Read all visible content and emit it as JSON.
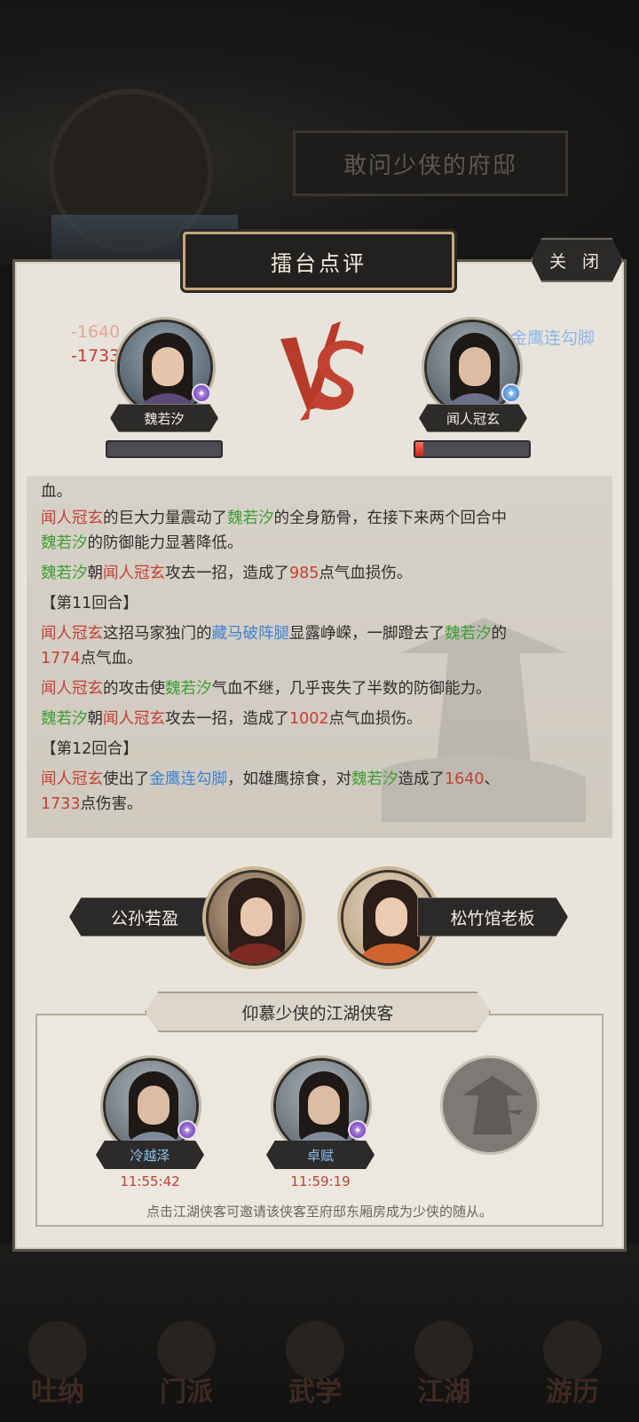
{
  "background": {
    "banner_text": "敢问少侠的府邸",
    "nav": [
      "吐纳",
      "门派",
      "武学",
      "江湖",
      "游历"
    ]
  },
  "dialog": {
    "title": "擂台点评",
    "close_label": "关 闭"
  },
  "fighters": {
    "left": {
      "name": "魏若汐",
      "damage_popups": [
        "-1640",
        "-1733"
      ],
      "hp_fraction": 0.0
    },
    "right": {
      "name": "闻人冠玄",
      "skill_popup": "金鹰连勾脚",
      "hp_fraction": 0.07
    }
  },
  "log": {
    "line0": "血。",
    "p1": {
      "a": "闻人冠玄",
      "b": "的巨大力量震动了",
      "c": "魏若汐",
      "d": "的全身筋骨，在接下来两个回合中",
      "e": "魏若汐",
      "f": "的防御能力显著降低。"
    },
    "p2": {
      "a": "魏若汐",
      "b": "朝",
      "c": "闻人冠玄",
      "d": "攻去一招，造成了",
      "e": "985",
      "f": "点气血损伤。"
    },
    "round11": "【第11回合】",
    "p3": {
      "a": "闻人冠玄",
      "b": "这招马家独门的",
      "c": "藏马破阵腿",
      "d": "显露峥嵘，一脚蹬去了",
      "e": "魏若汐",
      "f": "的",
      "g": "1774",
      "h": "点气血。"
    },
    "p4": {
      "a": "闻人冠玄",
      "b": "的攻击使",
      "c": "魏若汐",
      "d": "气血不继，几乎丧失了半数的防御能力。"
    },
    "p5": {
      "a": "魏若汐",
      "b": "朝",
      "c": "闻人冠玄",
      "d": "攻去一招，造成了",
      "e": "1002",
      "f": "点气血损伤。"
    },
    "round12": "【第12回合】",
    "p6": {
      "a": "闻人冠玄",
      "b": "使出了",
      "c": "金鹰连勾脚",
      "d": "，如雄鹰掠食，对",
      "e": "魏若汐",
      "f": "造成了",
      "g": "1640",
      "h": "、",
      "i": "1733",
      "j": "点伤害。"
    }
  },
  "guests": {
    "left": "公孙若盈",
    "right": "松竹馆老板"
  },
  "followers": {
    "title": "仰慕少侠的江湖侠客",
    "items": [
      {
        "name": "冷越泽",
        "timer": "11:55:42"
      },
      {
        "name": "卓赋",
        "timer": "11:59:19"
      }
    ],
    "hint": "点击江湖侠客可邀请该侠客至府邸东厢房成为少侠的随从。"
  },
  "colors": {
    "ally_green": "#3f9d35",
    "enemy_red": "#c43f33",
    "skill_blue": "#3f83d1",
    "panel_bg": "#e8e4dc"
  }
}
